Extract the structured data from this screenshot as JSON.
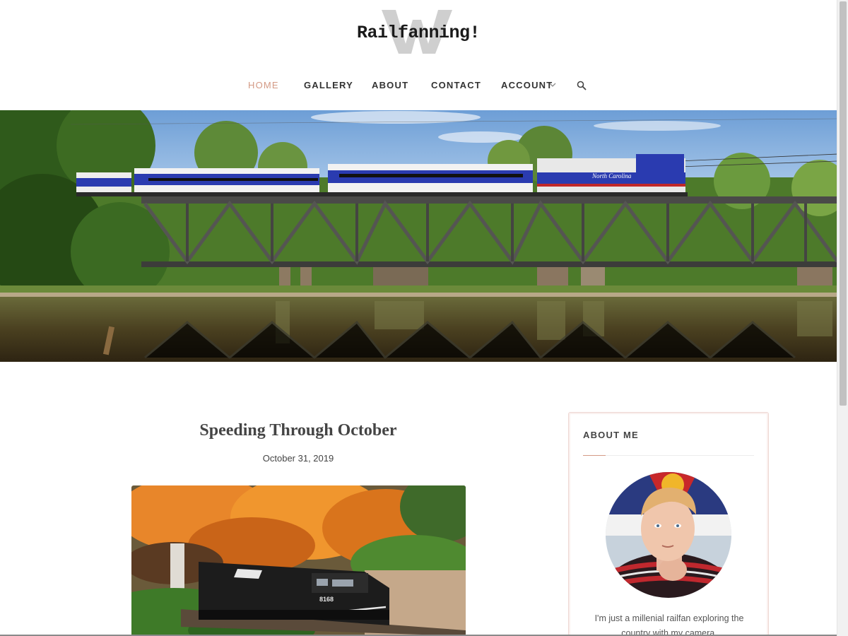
{
  "site": {
    "logo_text": "Railfanning!",
    "logo_icon": "w-monogram-icon"
  },
  "nav": {
    "items": [
      {
        "label": "HOME",
        "active": true
      },
      {
        "label": "GALLERY"
      },
      {
        "label": "ABOUT"
      },
      {
        "label": "CONTACT"
      },
      {
        "label": "ACCOUNT",
        "has_dropdown": true
      }
    ],
    "search_icon": "search-icon"
  },
  "hero": {
    "image": "passenger train crossing truss bridge over river",
    "locomotive_lettering": "North Carolina"
  },
  "post": {
    "title": "Speeding Through October",
    "date": "October 31, 2019",
    "image": "black locomotive passing orange autumn trees",
    "locomotive_number": "8168"
  },
  "sidebar": {
    "widget_title": "ABOUT ME",
    "text": "I'm just a millenial railfan exploring the country with my camera."
  },
  "colors": {
    "accent": "#d49a85",
    "text": "#444444",
    "widget_border": "#eed7d3"
  }
}
